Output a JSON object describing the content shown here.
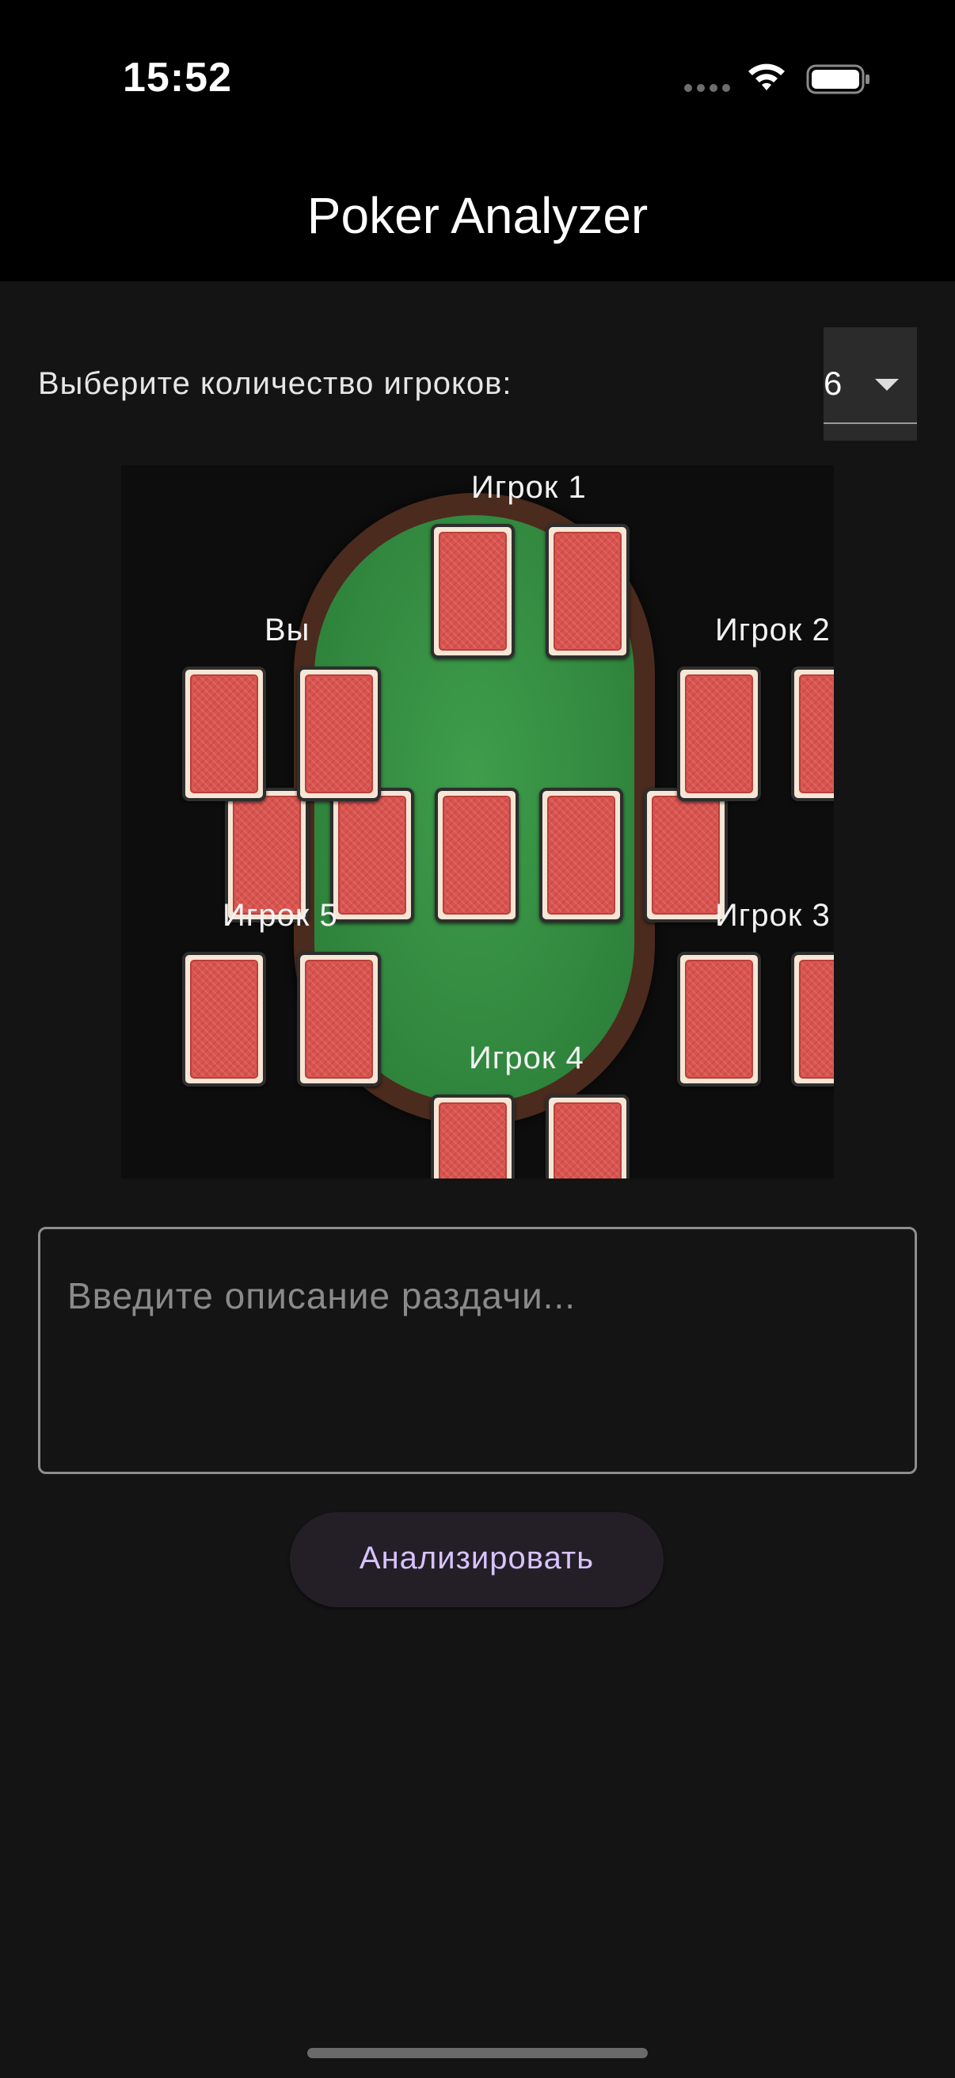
{
  "status_bar": {
    "time": "15:52"
  },
  "app": {
    "title": "Poker Analyzer"
  },
  "player_count": {
    "label": "Выберите количество игроков:",
    "selected": "6"
  },
  "table": {
    "seats": [
      "Игрок 1",
      "Вы",
      "Игрок 2",
      "Игрок 5",
      "Игрок 3",
      "Игрок 4"
    ]
  },
  "description": {
    "placeholder": "Введите описание раздачи..."
  },
  "actions": {
    "analyze_label": "Анализировать"
  },
  "colors": {
    "background": "#141414",
    "felt": "#36903f",
    "rim": "#4b2b1e",
    "card_back": "#d9544f",
    "button_text": "#d8c3ff"
  }
}
